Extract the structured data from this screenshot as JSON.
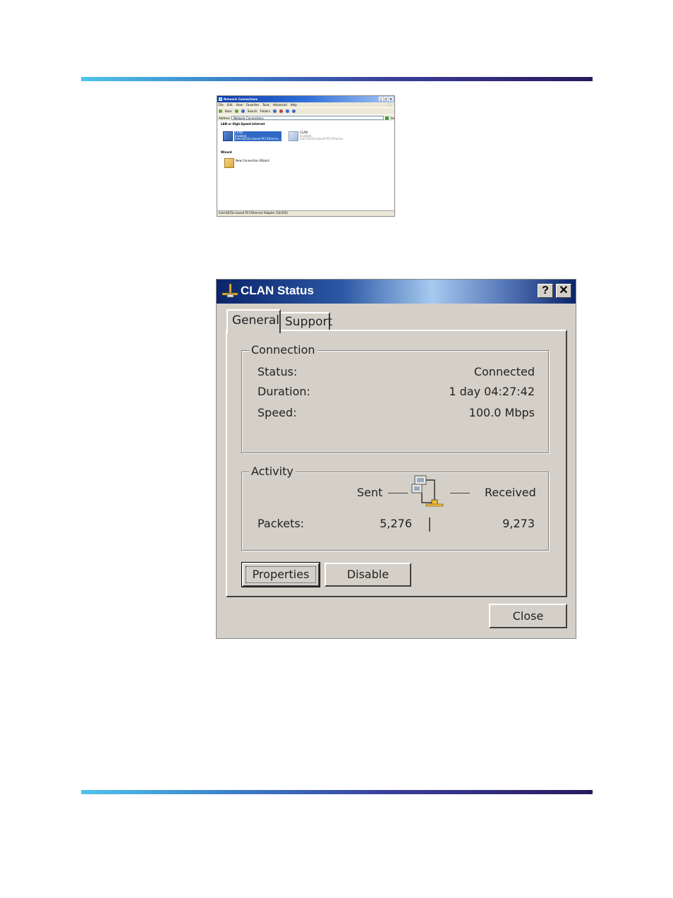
{
  "network_connections": {
    "title": "Network Connections",
    "menu": [
      "File",
      "Edit",
      "View",
      "Favorites",
      "Tools",
      "Advanced",
      "Help"
    ],
    "toolbar": [
      "Back",
      "Search",
      "Folders"
    ],
    "address_label": "Address",
    "address_value": "Network Connections",
    "go_label": "Go",
    "section_lan": "LAN or High-Speed Internet",
    "items": [
      {
        "name": "CLAN",
        "status": "Enabled",
        "adapter": "Intel 8255x-based PCI Etherne...",
        "selected": true
      },
      {
        "name": "CLAN",
        "status": "Enabled",
        "adapter": "Intel 8255x-based PCI Etherne...",
        "selected": false
      }
    ],
    "section_wizard": "Wizard",
    "wizard_item": "New Connection Wizard",
    "status_bar": "Intel 8255x-based PCI Ethernet Adapter (10/100)"
  },
  "dialog": {
    "title": "CLAN Status",
    "help_button": "?",
    "close_x": "✕",
    "tabs": [
      {
        "label": "General",
        "active": true
      },
      {
        "label": "Support",
        "active": false
      }
    ],
    "connection": {
      "legend": "Connection",
      "status_label": "Status:",
      "status_value": "Connected",
      "duration_label": "Duration:",
      "duration_value": "1 day 04:27:42",
      "speed_label": "Speed:",
      "speed_value": "100.0 Mbps"
    },
    "activity": {
      "legend": "Activity",
      "sent_label": "Sent",
      "received_label": "Received",
      "packets_label": "Packets:",
      "packets_sent": "5,276",
      "packets_received": "9,273"
    },
    "buttons": {
      "properties": "Properties",
      "disable": "Disable",
      "close": "Close"
    }
  },
  "colors": {
    "dialog_face": "#d4d0c8",
    "title_dark": "#0a246a",
    "rule_start": "#4fc3ea",
    "rule_end": "#2a1a5e"
  }
}
